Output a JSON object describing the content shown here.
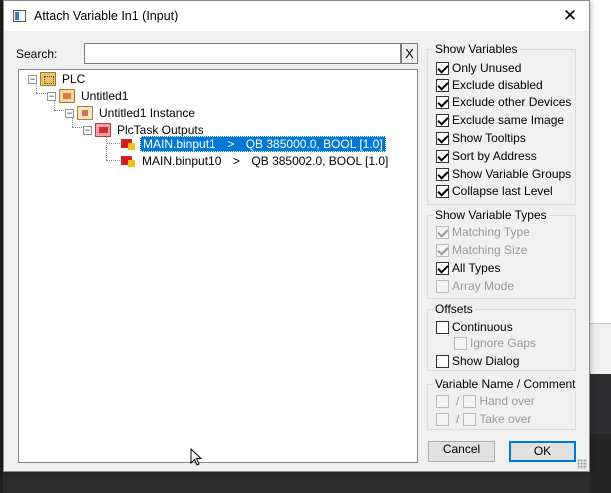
{
  "window": {
    "title": "Attach Variable In1 (Input)"
  },
  "search": {
    "label": "Search:",
    "value": "",
    "clear_label": "X"
  },
  "tree": {
    "root": "PLC",
    "project": "Untitled1",
    "instance": "Untitled1 Instance",
    "task": "PlcTask Outputs",
    "items": [
      {
        "name": "MAIN.binput1",
        "arrow": ">",
        "address": "QB 385000.0, BOOL [1.0]",
        "selected": true
      },
      {
        "name": "MAIN.binput10",
        "arrow": ">",
        "address": "QB 385002.0, BOOL [1.0]",
        "selected": false
      }
    ]
  },
  "show_variables": {
    "title": "Show Variables",
    "options": [
      {
        "label": "Only Unused",
        "checked": true
      },
      {
        "label": "Exclude disabled",
        "checked": true
      },
      {
        "label": "Exclude other Devices",
        "checked": true
      },
      {
        "label": "Exclude same Image",
        "checked": true
      },
      {
        "label": "Show Tooltips",
        "checked": true
      },
      {
        "label": "Sort by Address",
        "checked": true
      },
      {
        "label": "Show Variable Groups",
        "checked": true
      },
      {
        "label": "Collapse last Level",
        "checked": true
      }
    ]
  },
  "show_variable_types": {
    "title": "Show Variable Types",
    "options": [
      {
        "label": "Matching Type",
        "checked": true,
        "enabled": false
      },
      {
        "label": "Matching Size",
        "checked": true,
        "enabled": false
      },
      {
        "label": "All Types",
        "checked": true,
        "enabled": true
      },
      {
        "label": "Array Mode",
        "checked": false,
        "enabled": false
      }
    ]
  },
  "offsets": {
    "title": "Offsets",
    "continuous": "Continuous",
    "ignore_gaps": "Ignore Gaps",
    "show_dialog": "Show Dialog"
  },
  "variable_name": {
    "title": "Variable Name / Comment",
    "slash": "/",
    "hand_over": "Hand over",
    "take_over": "Take over"
  },
  "buttons": {
    "cancel": "Cancel",
    "ok": "OK"
  }
}
